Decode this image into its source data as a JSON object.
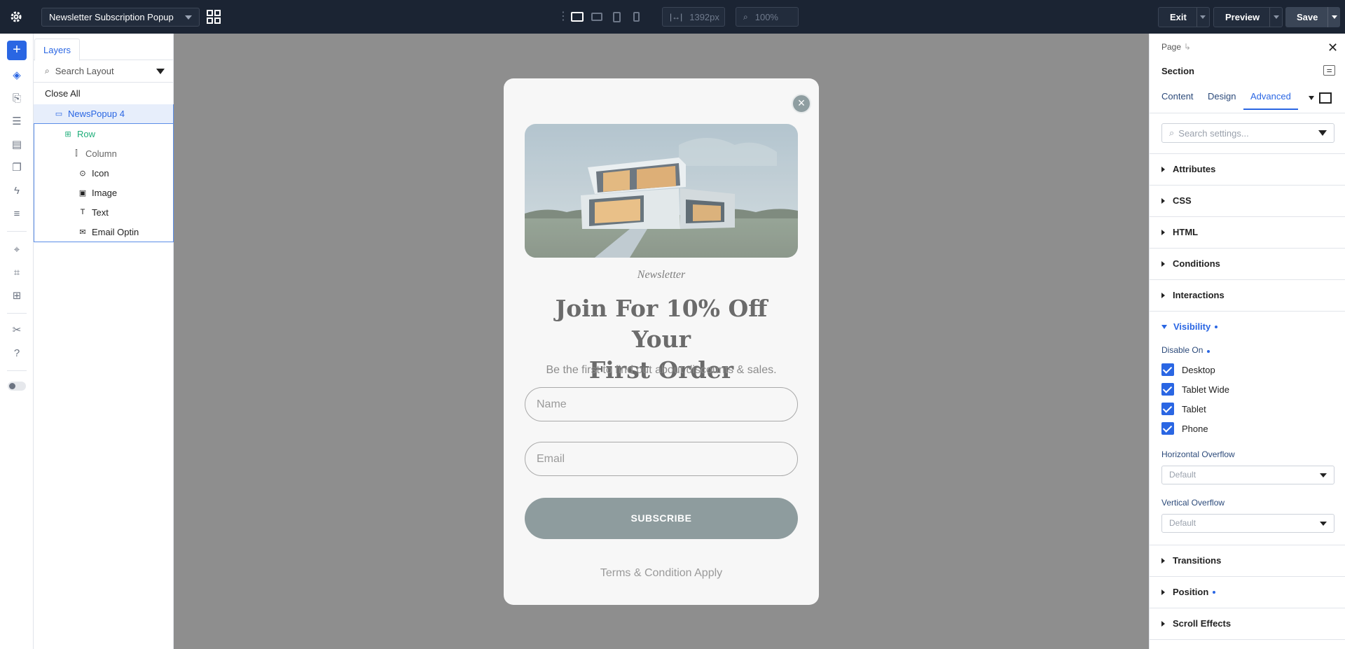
{
  "topbar": {
    "page_name": "Newsletter Subscription Popup",
    "width_value": "1392px",
    "zoom_value": "100%",
    "exit_label": "Exit",
    "preview_label": "Preview",
    "save_label": "Save"
  },
  "layers": {
    "tab_label": "Layers",
    "search_placeholder": "Search Layout",
    "close_all": "Close All",
    "nodes": [
      {
        "label": "NewsPopup 4"
      },
      {
        "label": "Row"
      },
      {
        "label": "Column"
      },
      {
        "label": "Icon"
      },
      {
        "label": "Image"
      },
      {
        "label": "Text"
      },
      {
        "label": "Email Optin"
      }
    ]
  },
  "popup": {
    "eyebrow": "Newsletter",
    "headline_line1": "Join For 10% Off Your",
    "headline_line2": "First Order",
    "subline": "Be the first to find out about discounts & sales.",
    "name_placeholder": "Name",
    "email_placeholder": "Email",
    "subscribe_label": "SUBSCRIBE",
    "terms": "Terms & Condition Apply"
  },
  "settings": {
    "crumb": "Page",
    "title": "Section",
    "tabs": [
      "Content",
      "Design",
      "Advanced"
    ],
    "search_placeholder": "Search settings...",
    "sections": [
      "Attributes",
      "CSS",
      "HTML",
      "Conditions",
      "Interactions"
    ],
    "visibility_label": "Visibility",
    "disable_on_label": "Disable On",
    "devices": [
      "Desktop",
      "Tablet Wide",
      "Tablet",
      "Phone"
    ],
    "h_overflow_label": "Horizontal Overflow",
    "h_overflow_value": "Default",
    "v_overflow_label": "Vertical Overflow",
    "v_overflow_value": "Default",
    "bottom_sections": [
      "Transitions",
      "Position",
      "Scroll Effects"
    ]
  },
  "colors": {
    "topbar_bg": "#1b2433",
    "accent": "#2a66e3",
    "canvas_bg": "#8e8e8e",
    "subscribe_bg": "#8e9c9e"
  }
}
